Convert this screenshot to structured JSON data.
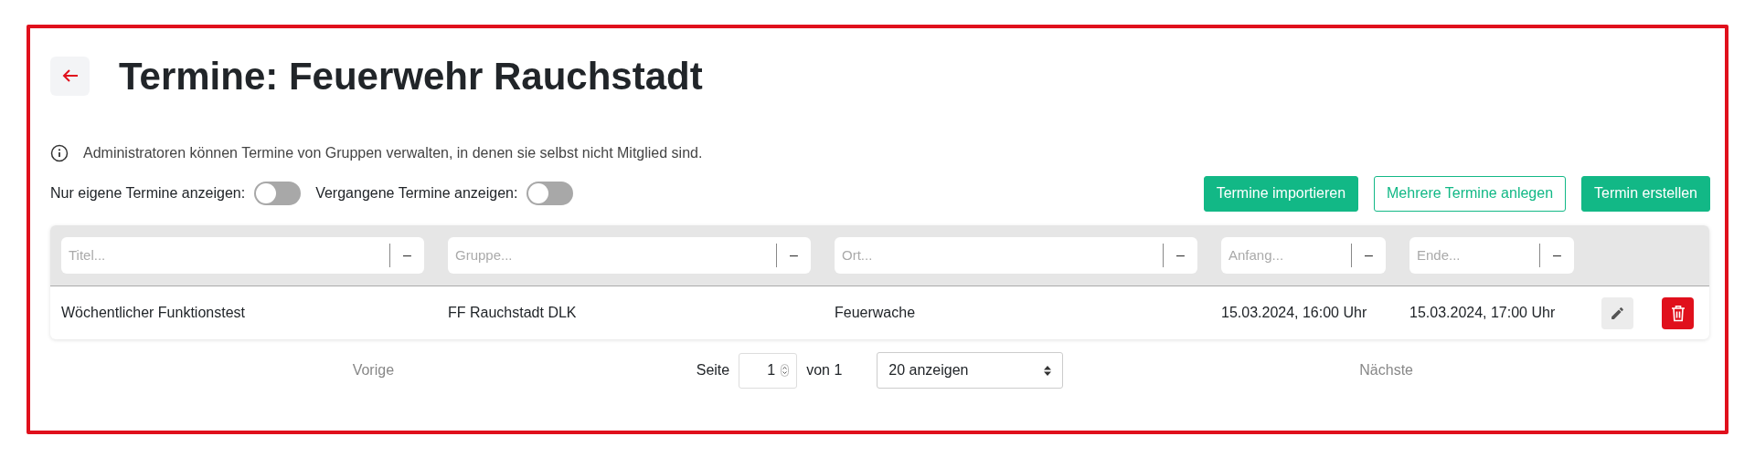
{
  "title": "Termine: Feuerwehr Rauchstadt",
  "info": "Administratoren können Termine von Gruppen verwalten, in denen sie selbst nicht Mitglied sind.",
  "toggles": [
    {
      "label": "Nur eigene Termine anzeigen:",
      "on": false
    },
    {
      "label": "Vergangene Termine anzeigen:",
      "on": false
    }
  ],
  "buttons": [
    {
      "label": "Termine importieren",
      "kind": "primary"
    },
    {
      "label": "Mehrere Termine anlegen",
      "kind": "outline"
    },
    {
      "label": "Termin erstellen",
      "kind": "primary"
    }
  ],
  "filters": [
    {
      "placeholder": "Titel...",
      "clear": "–"
    },
    {
      "placeholder": "Gruppe...",
      "clear": "–"
    },
    {
      "placeholder": "Ort...",
      "clear": "–"
    },
    {
      "placeholder": "Anfang...",
      "clear": "–"
    },
    {
      "placeholder": "Ende...",
      "clear": "–"
    }
  ],
  "rows": [
    {
      "cells": [
        "Wöchentlicher Funktionstest",
        "FF Rauchstadt DLK",
        "Feuerwache",
        "15.03.2024, 16:00 Uhr",
        "15.03.2024, 17:00 Uhr"
      ]
    }
  ],
  "pagination": {
    "previous": {
      "label": "Vorige",
      "disabled": true
    },
    "page_label": "Seite",
    "page": "1",
    "of": "von 1",
    "page_size": "20 anzeigen",
    "next": {
      "label": "Nächste",
      "disabled": true
    }
  }
}
